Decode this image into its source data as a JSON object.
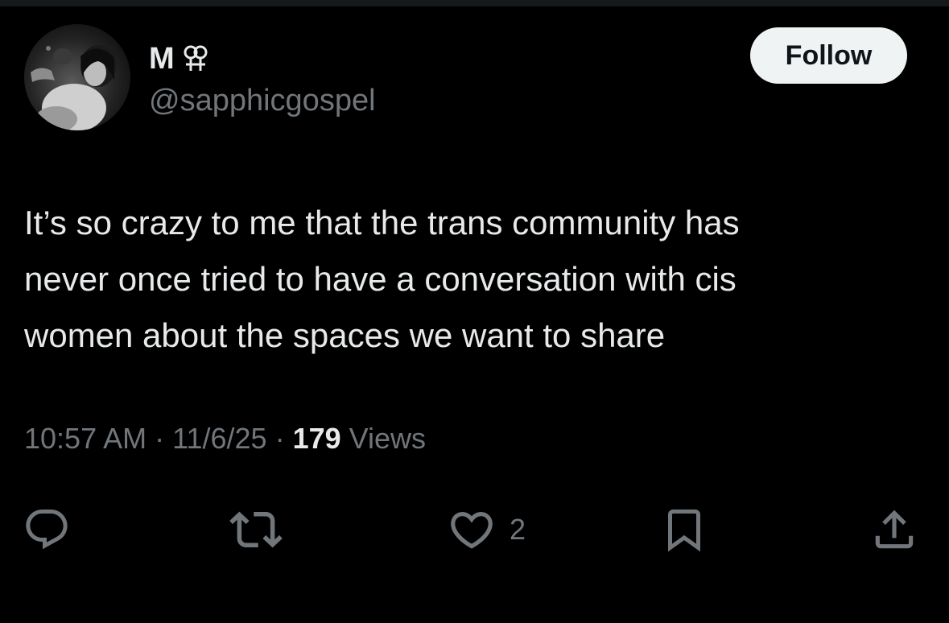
{
  "author": {
    "display_name": "M",
    "name_symbol": "lesbian-symbol-icon",
    "handle": "@sapphicgospel",
    "avatar": "profile-photo"
  },
  "follow_label": "Follow",
  "tweet": {
    "text": "It’s so crazy to me that the trans community has\nnever once tried to have a conversation with cis\nwomen about the spaces we want to share"
  },
  "meta": {
    "time": "10:57 AM",
    "separator": "·",
    "date": "11/6/25",
    "views_count": "179",
    "views_label": "Views"
  },
  "actions": {
    "reply": {
      "icon": "reply-icon"
    },
    "repost": {
      "icon": "repost-icon"
    },
    "like": {
      "icon": "heart-icon",
      "count": "2"
    },
    "bookmark": {
      "icon": "bookmark-icon"
    },
    "share": {
      "icon": "share-icon"
    }
  },
  "colors": {
    "background": "#000000",
    "primary_text": "#e7e9ea",
    "secondary_text": "#71767b",
    "follow_button_bg": "#eff3f4",
    "follow_button_text": "#0f1419"
  }
}
